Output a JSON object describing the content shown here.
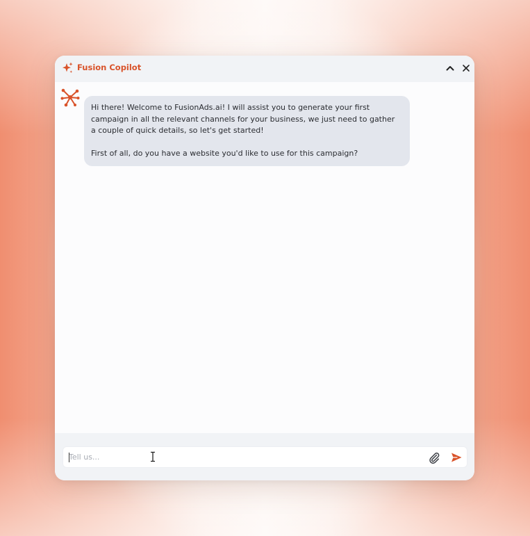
{
  "app": {
    "title": "Fusion Copilot",
    "accent_color": "#d9532a"
  },
  "header": {
    "icons": [
      "sparkle-icon",
      "chevron-up-icon",
      "close-icon"
    ]
  },
  "chat": {
    "messages": [
      {
        "sender": "bot",
        "avatar_icon": "network-node-icon",
        "paragraphs": [
          "Hi there! Welcome to FusionAds.ai! I will assist you to generate your first campaign in all the relevant channels for your business, we just need to gather a couple of quick details, so let's get started!",
          "First of all, do you have a website you'd like to use for this campaign?"
        ]
      }
    ]
  },
  "composer": {
    "placeholder": "Tell us...",
    "value": "",
    "icons": [
      "paperclip-icon",
      "send-icon"
    ]
  }
}
